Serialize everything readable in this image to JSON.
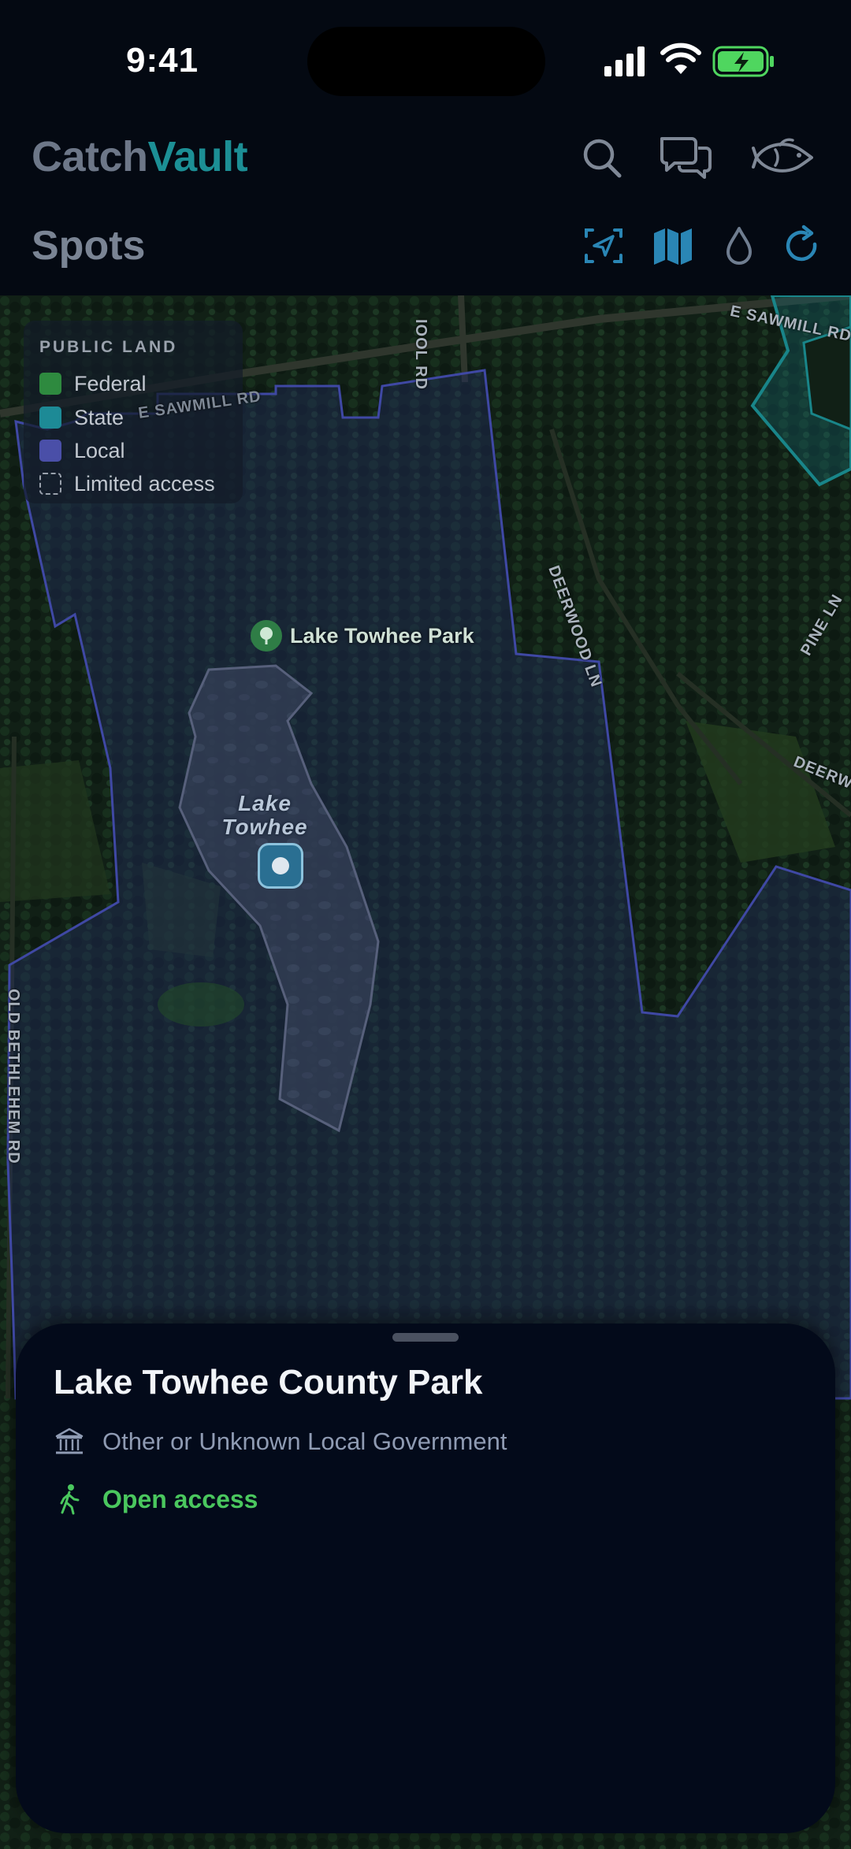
{
  "status_bar": {
    "time": "9:41"
  },
  "header": {
    "brand_part1": "Catch",
    "brand_part2": "Vault",
    "page_title": "Spots",
    "icons": [
      "search-icon",
      "chat-bubbles-icon",
      "fish-icon"
    ],
    "toolbar_icons": [
      "locate-frame-icon",
      "map-icon",
      "water-drop-icon",
      "refresh-icon"
    ],
    "accent_color": "#1c8f95"
  },
  "legend": {
    "title": "PUBLIC LAND",
    "items": [
      {
        "label": "Federal",
        "color": "#2e8a3f"
      },
      {
        "label": "State",
        "color": "#1d8a96"
      },
      {
        "label": "Local",
        "color": "#4a4fa8"
      },
      {
        "label": "Limited access",
        "color": "dashed"
      }
    ]
  },
  "map": {
    "park_label": "Lake Towhee Park",
    "lake_label_line1": "Lake",
    "lake_label_line2": "Towhee",
    "roads": {
      "sawmill_1": "E SAWMILL RD",
      "sawmill_2": "E SAWMILL RD",
      "school": "IOOL RD",
      "deerwood": "DEERWOOD LN",
      "pine": "PINE LN",
      "deerw": "DEERW",
      "bethlehem": "OLD BETHLEHEM RD"
    }
  },
  "sheet": {
    "title": "Lake Towhee County Park",
    "agency": "Other or Unknown Local Government",
    "access": "Open access",
    "access_color": "#4ac75e"
  }
}
